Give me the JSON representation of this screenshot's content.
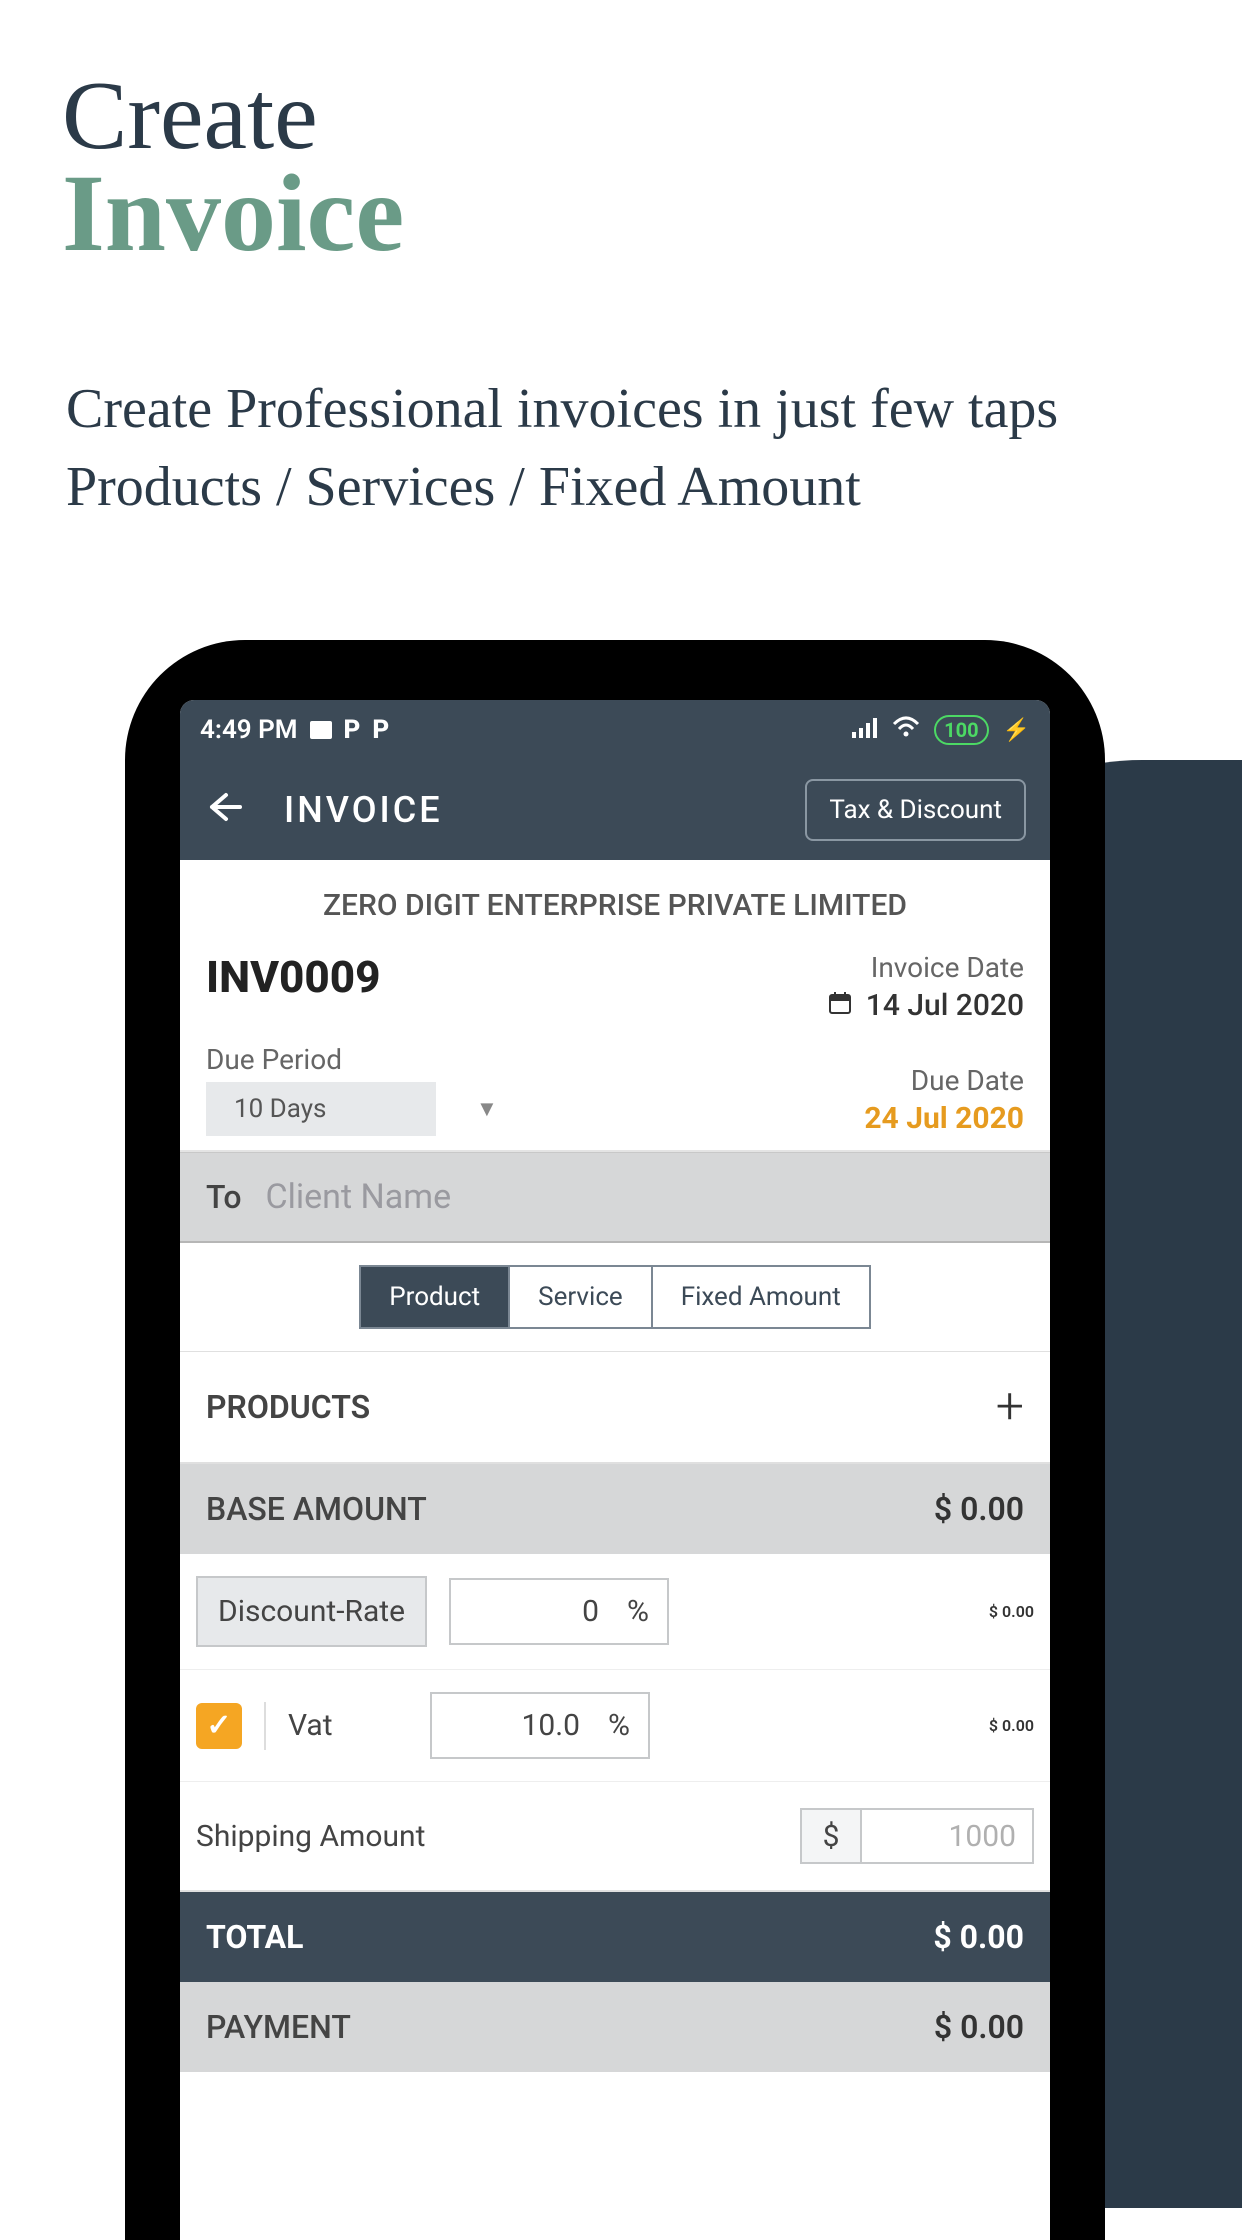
{
  "hero": {
    "title1": "Create",
    "title2": "Invoice",
    "sub1": "Create Professional invoices in just few taps",
    "sub2": "Products / Services / Fixed Amount"
  },
  "status": {
    "time": "4:49 PM",
    "battery": "100"
  },
  "appbar": {
    "title": "INVOICE",
    "tax_btn": "Tax & Discount"
  },
  "invoice": {
    "company": "ZERO DIGIT ENTERPRISE PRIVATE LIMITED",
    "number": "INV0009",
    "date_label": "Invoice Date",
    "date_value": "14 Jul 2020",
    "due_period_label": "Due Period",
    "due_period_value": "10 Days",
    "due_date_label": "Due Date",
    "due_date_value": "24 Jul 2020"
  },
  "to": {
    "label": "To",
    "placeholder": "Client Name"
  },
  "tabs": {
    "t1": "Product",
    "t2": "Service",
    "t3": "Fixed Amount"
  },
  "sections": {
    "products": "PRODUCTS",
    "base_amount": "BASE AMOUNT",
    "base_amount_val": "$ 0.00",
    "discount_label": "Discount-Rate",
    "discount_val": "0",
    "discount_unit": "%",
    "discount_amount": "$ 0.00",
    "vat_label": "Vat",
    "vat_val": "10.0",
    "vat_unit": "%",
    "vat_amount": "$ 0.00",
    "shipping_label": "Shipping Amount",
    "shipping_currency": "$",
    "shipping_placeholder": "1000",
    "total_label": "TOTAL",
    "total_val": "$ 0.00",
    "payment_label": "PAYMENT",
    "payment_val": "$ 0.00"
  }
}
